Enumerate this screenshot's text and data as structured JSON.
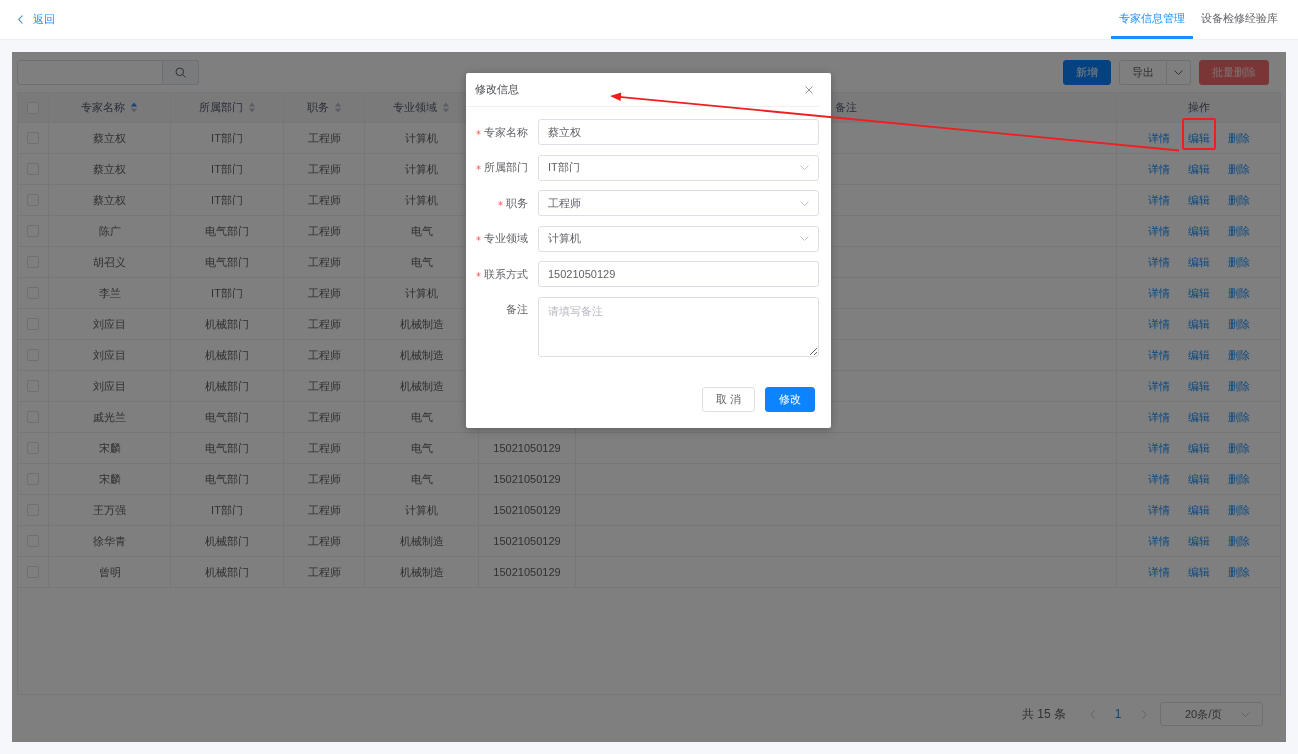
{
  "top_bar": {
    "back": "返回",
    "tabs": [
      {
        "label": "专家信息管理",
        "selected": true
      },
      {
        "label": "设备检修经验库",
        "selected": false
      }
    ]
  },
  "toolbar": {
    "buttons": [
      {
        "label": "新增",
        "kind": "primary"
      },
      {
        "label": "导出",
        "kind": "split"
      },
      {
        "label": "批量删除",
        "kind": "danger"
      }
    ]
  },
  "table": {
    "select_all": {
      "checked": false
    },
    "columns": [
      {
        "label": "专家名称",
        "sortable": true,
        "sorted": true
      },
      {
        "label": "所属部门",
        "sortable": true,
        "sorted": false
      },
      {
        "label": "职务",
        "sortable": true,
        "sorted": false
      },
      {
        "label": "专业领域",
        "sortable": true,
        "sorted": false
      },
      {
        "label": "备注",
        "sortable": false
      },
      {
        "label": "操作",
        "sortable": false
      }
    ],
    "rows": [
      {
        "checked": false,
        "name": "蔡立权",
        "department": "IT部门",
        "position": "工程师",
        "field": "计算机",
        "actions": [
          "详情",
          "编辑",
          "删除"
        ]
      },
      {
        "checked": false,
        "name": "蔡立权",
        "department": "IT部门",
        "position": "工程师",
        "field": "计算机",
        "actions": [
          "详情",
          "编辑",
          "删除"
        ]
      },
      {
        "checked": false,
        "name": "蔡立权",
        "department": "IT部门",
        "position": "工程师",
        "field": "计算机",
        "actions": [
          "详情",
          "编辑",
          "删除"
        ]
      },
      {
        "checked": false,
        "name": "陈广",
        "department": "电气部门",
        "position": "工程师",
        "field": "电气",
        "actions": [
          "详情",
          "编辑",
          "删除"
        ]
      },
      {
        "checked": false,
        "name": "胡召义",
        "department": "电气部门",
        "position": "工程师",
        "field": "电气",
        "actions": [
          "详情",
          "编辑",
          "删除"
        ]
      },
      {
        "checked": false,
        "name": "李兰",
        "department": "IT部门",
        "position": "工程师",
        "field": "计算机",
        "actions": [
          "详情",
          "编辑",
          "删除"
        ]
      },
      {
        "checked": false,
        "name": "刘应目",
        "department": "机械部门",
        "position": "工程师",
        "field": "机械制造",
        "actions": [
          "详情",
          "编辑",
          "删除"
        ]
      },
      {
        "checked": false,
        "name": "刘应目",
        "department": "机械部门",
        "position": "工程师",
        "field": "机械制造",
        "actions": [
          "详情",
          "编辑",
          "删除"
        ]
      },
      {
        "checked": false,
        "name": "刘应目",
        "department": "机械部门",
        "position": "工程师",
        "field": "机械制造",
        "actions": [
          "详情",
          "编辑",
          "删除"
        ]
      },
      {
        "checked": false,
        "name": "戚光兰",
        "department": "电气部门",
        "position": "工程师",
        "field": "电气",
        "actions": [
          "详情",
          "编辑",
          "删除"
        ]
      },
      {
        "checked": false,
        "name": "宋麟",
        "department": "电气部门",
        "position": "工程师",
        "field": "电气",
        "phone": "15021050129",
        "actions": [
          "详情",
          "编辑",
          "删除"
        ]
      },
      {
        "checked": false,
        "name": "宋麟",
        "department": "电气部门",
        "position": "工程师",
        "field": "电气",
        "phone": "15021050129",
        "actions": [
          "详情",
          "编辑",
          "删除"
        ]
      },
      {
        "checked": false,
        "name": "王万强",
        "department": "IT部门",
        "position": "工程师",
        "field": "计算机",
        "phone": "15021050129",
        "actions": [
          "详情",
          "编辑",
          "删除"
        ]
      },
      {
        "checked": false,
        "name": "徐华青",
        "department": "机械部门",
        "position": "工程师",
        "field": "机械制造",
        "phone": "15021050129",
        "actions": [
          "详情",
          "编辑",
          "删除"
        ]
      },
      {
        "checked": false,
        "name": "曾明",
        "department": "机械部门",
        "position": "工程师",
        "field": "机械制造",
        "phone": "15021050129",
        "actions": [
          "详情",
          "编辑",
          "删除"
        ]
      }
    ]
  },
  "pagination": {
    "total": "共 15 条",
    "prev_disabled": true,
    "pages": [
      {
        "label": "1",
        "selected": true
      }
    ],
    "next_disabled": true,
    "page_size": "20条/页"
  },
  "dialog": {
    "title": "修改信息",
    "fields": [
      {
        "label": "专家名称",
        "required": true,
        "kind": "input",
        "value": "蔡立权"
      },
      {
        "label": "所属部门",
        "required": true,
        "kind": "select",
        "value": "IT部门"
      },
      {
        "label": "职务",
        "required": true,
        "kind": "select",
        "value": "工程师"
      },
      {
        "label": "专业领域",
        "required": true,
        "kind": "select",
        "value": "计算机"
      },
      {
        "label": "联系方式",
        "required": true,
        "kind": "input",
        "value": "15021050129"
      },
      {
        "label": "备注",
        "required": false,
        "kind": "textarea",
        "placeholder": "请填写备注"
      }
    ],
    "buttons": [
      {
        "label": "取 消",
        "kind": "default"
      },
      {
        "label": "修改",
        "kind": "primary"
      }
    ]
  },
  "annotations": {
    "edit_frame": true,
    "arrow_to_dialog": true
  }
}
